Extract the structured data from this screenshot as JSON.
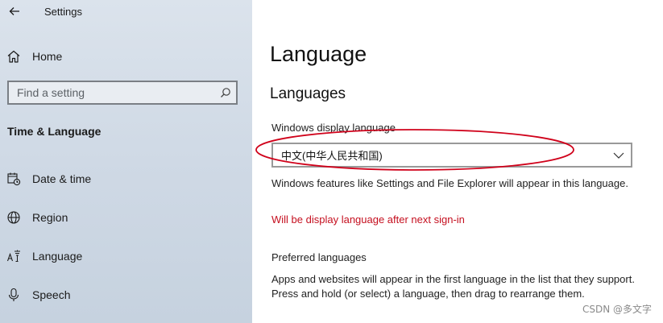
{
  "window": {
    "title": "Settings"
  },
  "sidebar": {
    "home_label": "Home",
    "search_placeholder": "Find a setting",
    "section_title": "Time & Language",
    "items": [
      {
        "label": "Date & time",
        "icon": "calendar-clock-icon"
      },
      {
        "label": "Region",
        "icon": "globe-icon"
      },
      {
        "label": "Language",
        "icon": "language-icon"
      },
      {
        "label": "Speech",
        "icon": "microphone-icon"
      }
    ]
  },
  "main": {
    "page_title": "Language",
    "section_title": "Languages",
    "display_language_label": "Windows display language",
    "display_language_value": "中文(中华人民共和国)",
    "display_language_note": "Windows features like Settings and File Explorer will appear in this language.",
    "warning": "Will be display language after next sign-in",
    "preferred_label": "Preferred languages",
    "preferred_desc": "Apps and websites will appear in the first language in the list that they support. Press and hold (or select) a language, then drag to rearrange them."
  },
  "watermark": "CSDN @多文字",
  "colors": {
    "warning": "#c50f1f",
    "annotation": "#d0021b",
    "sidebar_bg": "#cfd9e5"
  }
}
